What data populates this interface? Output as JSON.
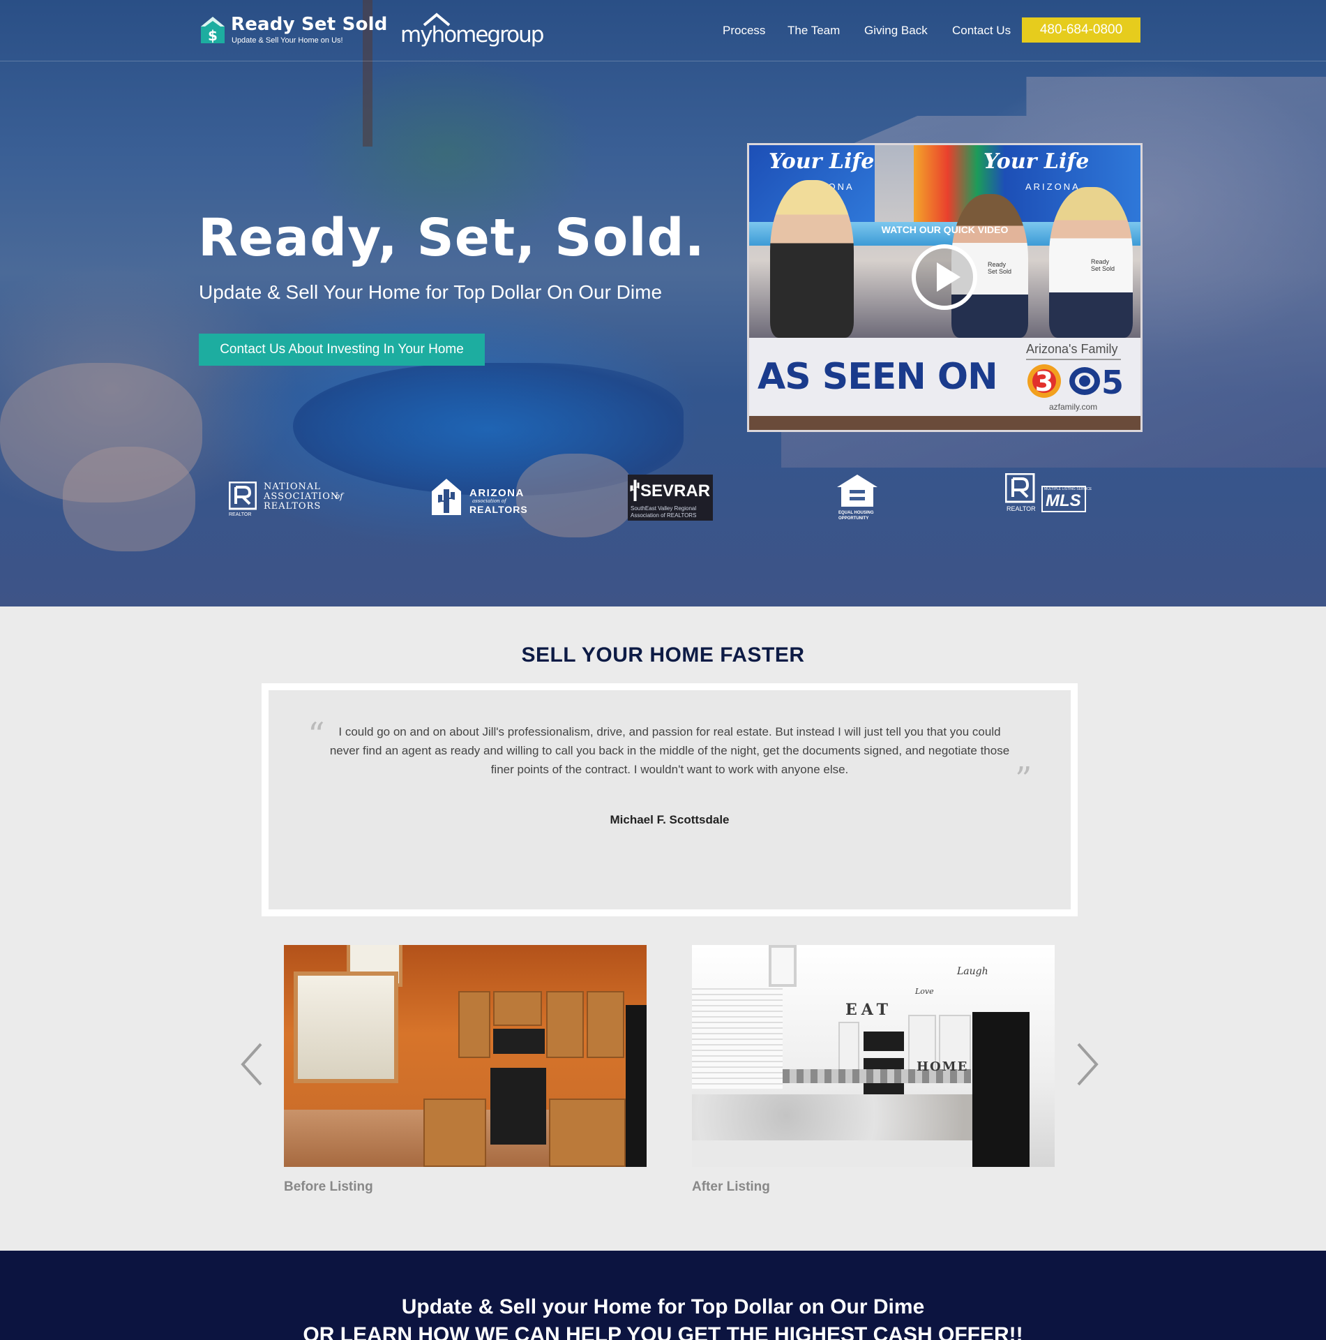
{
  "header": {
    "brand_name": "Ready Set Sold",
    "brand_tagline": "Update & Sell Your Home on Us!",
    "partner_logo": "myhomegroup",
    "nav": [
      {
        "label": "Process"
      },
      {
        "label": "The Team"
      },
      {
        "label": "Giving Back"
      },
      {
        "label": "Contact Us"
      }
    ],
    "phone": "480-684-0800"
  },
  "hero": {
    "title": "Ready, Set, Sold.",
    "subtitle": "Update & Sell Your Home for Top Dollar On Our Dime",
    "cta_label": "Contact Us About Investing In Your Home"
  },
  "video_card": {
    "show_name": "Your Life",
    "show_region_left": "IZONA",
    "show_region_right": "ARIZONA",
    "watch_label": "WATCH OUR QUICK VIDEO",
    "as_seen_on": "AS SEEN ON",
    "network": "Arizona's Family",
    "channel_3": "3",
    "channel_5": "5",
    "url": "azfamily.com",
    "shirt_text_1": "Ready Set Sold",
    "shirt_text_2": "Ready Set Sold"
  },
  "badges": {
    "nar": {
      "line1": "NATIONAL",
      "line2": "ASSOCIATION",
      "of": "of",
      "line3": "REALTORS",
      "sub": "REALTOR"
    },
    "aar": {
      "line1": "ARIZONA",
      "line2": "association of",
      "line3": "REALTORS"
    },
    "sevrar": {
      "name": "SEVRAR",
      "line1": "SouthEast Valley Regional",
      "line2": "Association of REALTORS"
    },
    "eho": {
      "line1": "EQUAL HOUSING",
      "line2": "OPPORTUNITY"
    },
    "mls": {
      "sub": "REALTOR",
      "name": "MLS",
      "tiny": "MULTIPLE LISTING SERVICE"
    }
  },
  "testimonials": {
    "section_title": "SELL YOUR HOME FASTER",
    "quote": "I could go on and on about Jill's professionalism, drive, and passion for real estate. But instead I will just tell you that you could never find an agent as ready and willing to call you back in the middle of the night, get the documents signed, and negotiate those finer points of the contract. I wouldn't want to work with anyone else.",
    "author": "Michael F. Scottsdale"
  },
  "gallery": {
    "before_label": "Before Listing",
    "after_label": "After Listing",
    "after_wall_words": [
      "EAT",
      "HOME",
      "Love",
      "Laugh"
    ]
  },
  "cta_band": {
    "line1": "Update & Sell your Home for Top Dollar on Our Dime",
    "line2": "OR LEARN HOW WE CAN HELP YOU GET THE HIGHEST CASH OFFER!!"
  },
  "colors": {
    "navy": "#0c1440",
    "title_navy": "#0d1b45",
    "teal": "#1dada0",
    "yellow": "#e6cc1d",
    "background": "#ebebeb"
  }
}
